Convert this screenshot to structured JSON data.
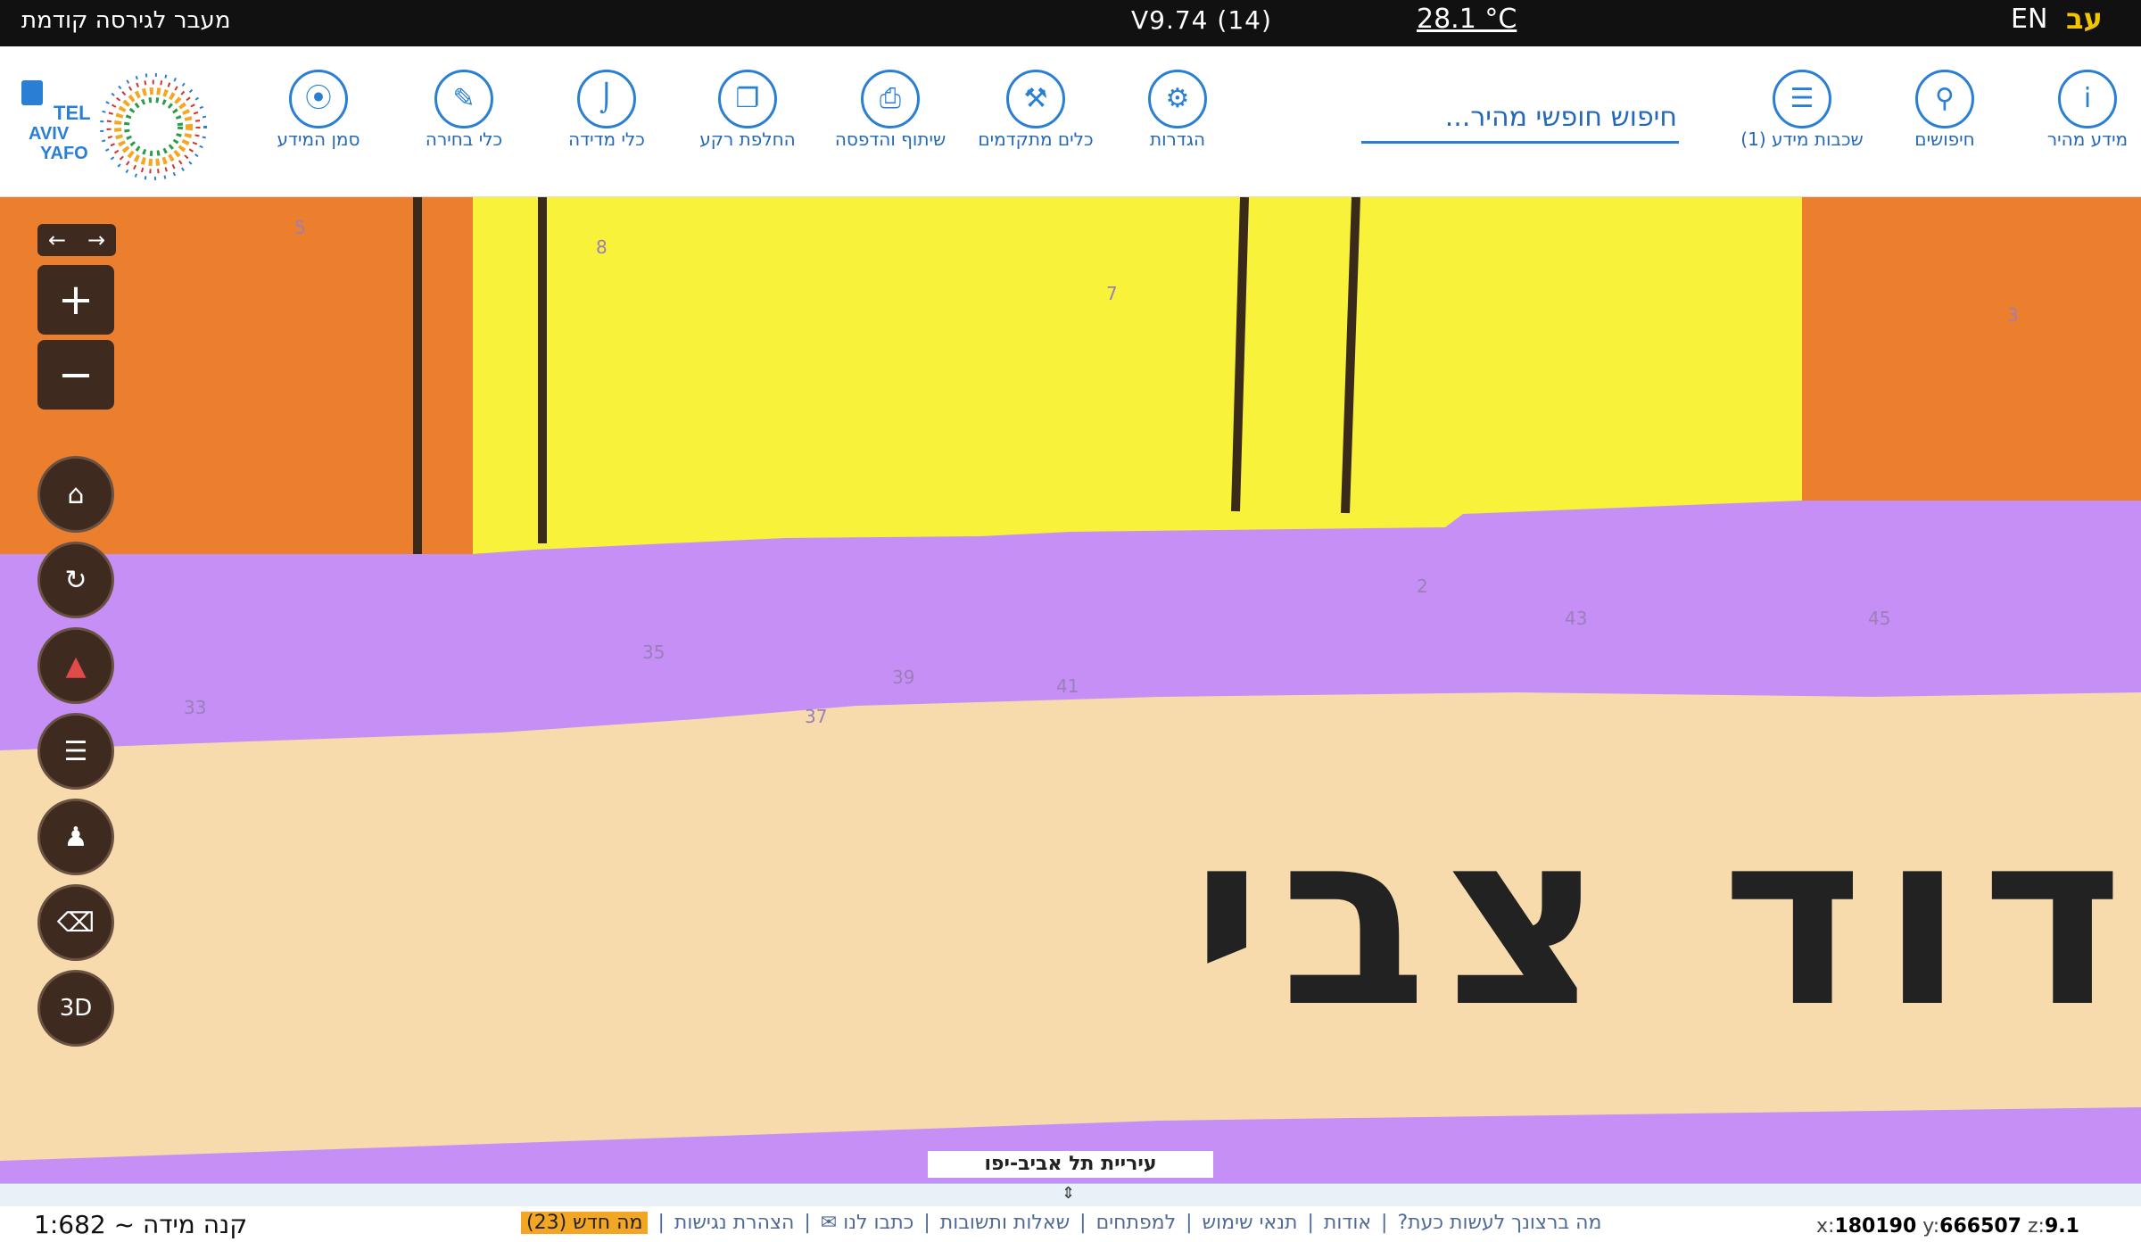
{
  "topbar": {
    "prev_version": "מעבר לגירסה קודמת",
    "version": "V9.74 (14)",
    "temperature": "28.1 °C",
    "lang_en": "EN",
    "lang_he": "עב"
  },
  "toolbar": {
    "tools": [
      {
        "label": "מידע מהיר",
        "icon": "info-icon"
      },
      {
        "label": "חיפושים",
        "icon": "search-icon"
      },
      {
        "label": "שכבות מידע (1)",
        "icon": "layers-icon"
      },
      {
        "label": "הגדרות",
        "icon": "gear-icon"
      },
      {
        "label": "כלים מתקדמים",
        "icon": "tools-icon"
      },
      {
        "label": "שיתוף והדפסה",
        "icon": "print-icon"
      },
      {
        "label": "החלפת רקע",
        "icon": "basemap-icon"
      },
      {
        "label": "כלי מדידה",
        "icon": "ruler-icon"
      },
      {
        "label": "כלי בחירה",
        "icon": "select-icon"
      },
      {
        "label": "סמן המידע",
        "icon": "pin-icon"
      }
    ],
    "search_placeholder": "חיפוש חופשי מהיר...",
    "logo_text": "TEL AVIV YAFO תל אביב יפו"
  },
  "map": {
    "street_label": "דוד צבי",
    "city_label": "עיריית תל אביב-יפו",
    "zoom_in": "+",
    "zoom_out": "−",
    "btn_3d": "3D",
    "colors": {
      "orange": "#ec7f2e",
      "yellow": "#f9f23a",
      "purple": "#c58ff5",
      "beige": "#f7dbad"
    }
  },
  "bottom": {
    "scale": "קנה מידה ~ 1:682",
    "links": [
      "מה ברצונך לעשות כעת?",
      "אודות",
      "תנאי שימוש",
      "למפתחים",
      "שאלות ותשובות",
      "כתבו לנו ✉",
      "הצהרת נגישות"
    ],
    "new_badge": "מה חדש (23)",
    "coords_x_label": "x:",
    "coords_x": "180190",
    "coords_y_label": "y:",
    "coords_y": "666507",
    "coords_z_label": "z:",
    "coords_z": "9.1"
  }
}
